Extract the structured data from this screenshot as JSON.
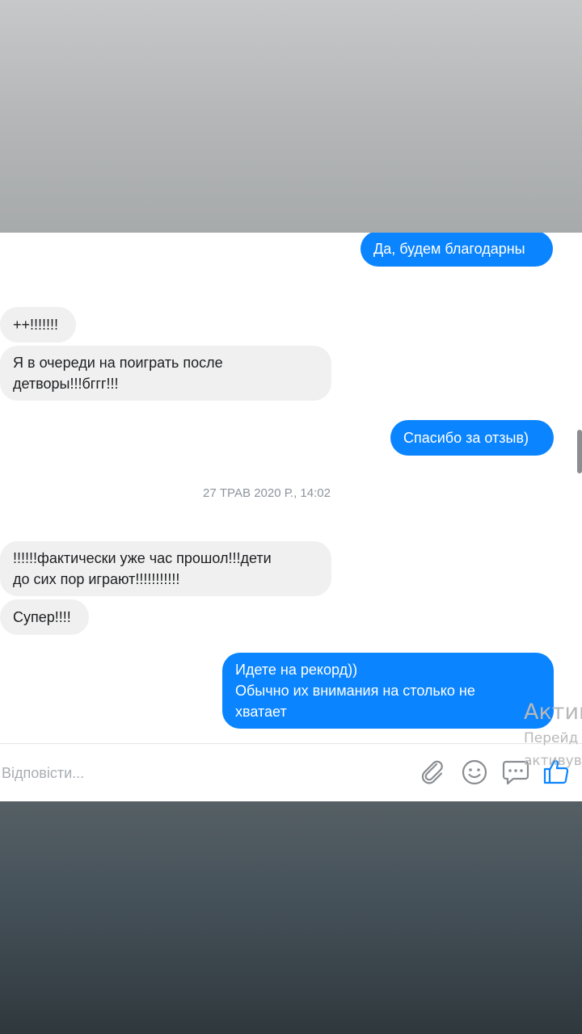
{
  "messages": [
    {
      "direction": "outgoing",
      "text": "Да, будем благодарны"
    },
    {
      "direction": "incoming",
      "text": "++!!!!!!!"
    },
    {
      "direction": "incoming",
      "text": "Я в очереди на поиграть после\nдетворы!!!бггг!!!"
    },
    {
      "direction": "outgoing",
      "text": "Спасибо за отзыв)"
    },
    {
      "direction": "incoming",
      "text": "!!!!!!фактически уже час прошол!!!дети\nдо сих пор играют!!!!!!!!!!!"
    },
    {
      "direction": "incoming",
      "text": "Супер!!!!"
    },
    {
      "direction": "outgoing",
      "text": "Идете на рекорд))\nОбычно их внимания на столько не\nхватает"
    }
  ],
  "timestamp": "27 ТРАВ 2020 Р., 14:02",
  "composer": {
    "placeholder": "Відповісти...",
    "icons": [
      "attach-icon",
      "emoji-icon",
      "gif-icon",
      "like-icon"
    ]
  },
  "watermark": {
    "line1": "Актив",
    "line2": "Перейд",
    "line3": "активув"
  },
  "colors": {
    "outgoing_bubble": "#0a84ff",
    "incoming_bubble": "#f1f0f0",
    "icon": "#8a8d91",
    "like": "#0a84ff"
  }
}
